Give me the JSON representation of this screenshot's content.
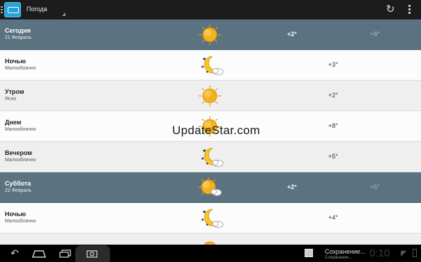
{
  "action_bar": {
    "title": "Погода",
    "icons": {
      "menu": "menu-lines-icon",
      "app": "weather-app-icon",
      "refresh": "refresh-icon",
      "overflow": "overflow-icon"
    }
  },
  "forecast": [
    {
      "kind": "day",
      "title": "Сегодня",
      "subtitle": "21 Февраль",
      "icon": "sun",
      "temp_main": "+2°",
      "temp_alt": "+8°"
    },
    {
      "kind": "period",
      "title": "Ночью",
      "subtitle": "Малооблачно",
      "icon": "moon-cloud",
      "temp": "+3°"
    },
    {
      "kind": "period",
      "title": "Утром",
      "subtitle": "Ясно",
      "icon": "sun",
      "temp": "+2°"
    },
    {
      "kind": "period",
      "title": "Днем",
      "subtitle": "Малооблачно",
      "icon": "sun",
      "temp": "+8°"
    },
    {
      "kind": "period",
      "title": "Вечером",
      "subtitle": "Малооблачно",
      "icon": "moon-cloud",
      "temp": "+5°"
    },
    {
      "kind": "day",
      "title": "Суббота",
      "subtitle": "22 Февраль",
      "icon": "sun-cloud",
      "temp_main": "+2°",
      "temp_alt": "+6°"
    },
    {
      "kind": "period",
      "title": "Ночью",
      "subtitle": "Малооблачно",
      "icon": "moon-cloud",
      "temp": "+4°"
    }
  ],
  "watermark": "UpdateStar.com",
  "system_bar": {
    "notification_title": "Сохранение...",
    "notification_subtitle": "Сохранение...",
    "clock": "0:10",
    "icons": {
      "back": "back-icon",
      "home": "home-icon",
      "recents": "recents-icon",
      "screenshot": "screenshot-icon",
      "wifi": "wifi-icon",
      "battery": "battery-icon"
    }
  },
  "colors": {
    "day_header": "#5b7380",
    "action_bar": "#1c1c1c",
    "sun": "#f2b21e",
    "moon": "#f5c62d"
  }
}
